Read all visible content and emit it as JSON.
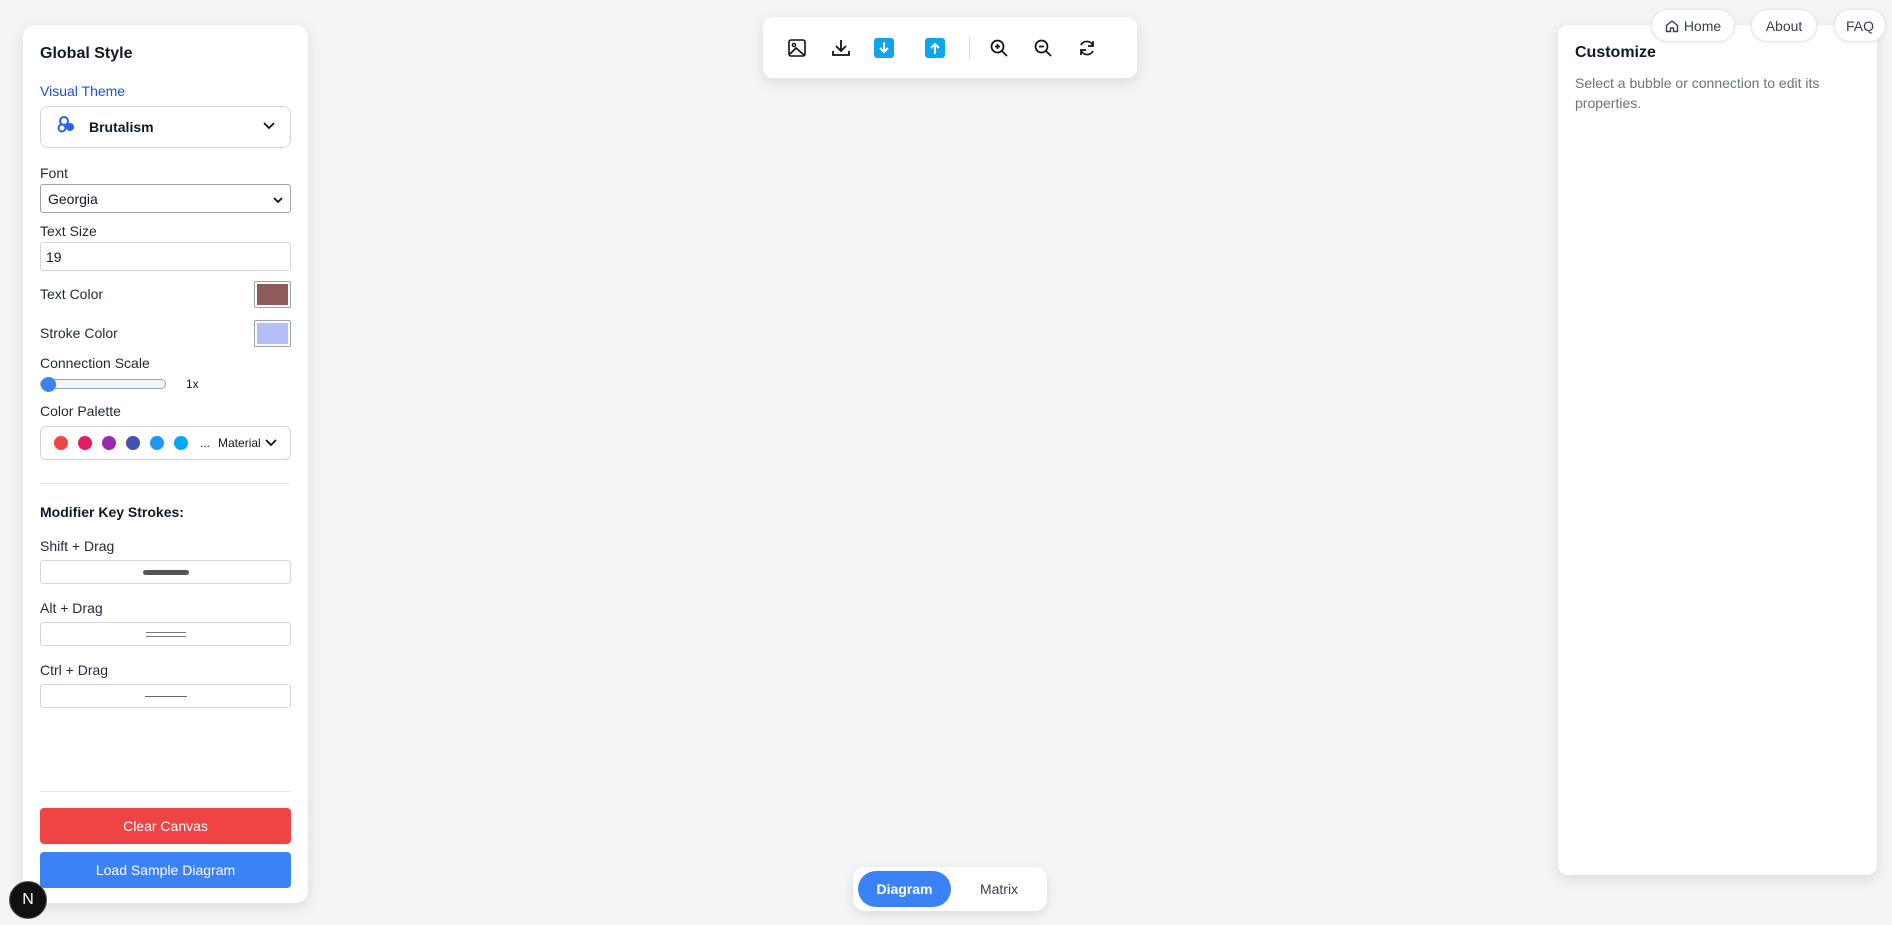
{
  "left": {
    "title": "Global Style",
    "theme_label": "Visual Theme",
    "theme_value": "Brutalism",
    "font_label": "Font",
    "font_value": "Georgia",
    "size_label": "Text Size",
    "size_value": "19",
    "text_color_label": "Text Color",
    "text_color": "#8f5a5a",
    "stroke_color_label": "Stroke Color",
    "stroke_color": "#b5bff7",
    "scale_label": "Connection Scale",
    "scale_value": "1x",
    "scale_fraction": 0.0,
    "palette_label": "Color Palette",
    "palette_colors": [
      "#ef4444",
      "#e11d63",
      "#9c27b0",
      "#3f51b5",
      "#2196f3",
      "#03a9f4"
    ],
    "palette_more": "...",
    "palette_name": "Material",
    "modifier_title": "Modifier Key Strokes:",
    "modifiers": [
      {
        "label": "Shift + Drag",
        "style": "thick"
      },
      {
        "label": "Alt + Drag",
        "style": "double"
      },
      {
        "label": "Ctrl + Drag",
        "style": "thin"
      }
    ],
    "clear_label": "Clear Canvas",
    "sample_label": "Load Sample Diagram"
  },
  "toolbar": {
    "icons": [
      "image-icon",
      "download-icon",
      "import-icon",
      "export-icon",
      "zoom-in-icon",
      "zoom-out-icon",
      "refresh-icon"
    ],
    "accent": "#0ea5e9"
  },
  "right": {
    "title": "Customize",
    "hint": "Select a bubble or connection to edit its properties."
  },
  "nav": {
    "home": "Home",
    "about": "About",
    "faq": "FAQ"
  },
  "view_switch": {
    "active": "Diagram",
    "inactive": "Matrix",
    "accent": "#3b82f6"
  },
  "badge": "N"
}
